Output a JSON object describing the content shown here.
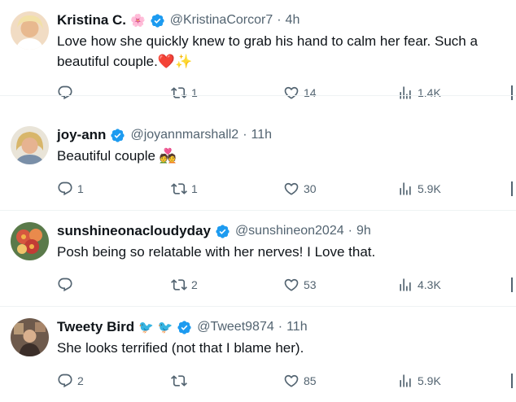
{
  "tweets": [
    {
      "name": "Kristina C.",
      "name_emoji": "🌸",
      "handle": "@KristinaCorcor7",
      "time": "4h",
      "text": "Love how she quickly knew to grab his hand to calm her fear.  Such a beautiful couple.",
      "text_emoji": "❤️✨",
      "replies": "",
      "retweets": "1",
      "likes": "14",
      "views": "1.4K",
      "avatar_color": "#e8c9a8"
    },
    {
      "name": "joy-ann",
      "name_emoji": "",
      "handle": "@joyannmarshall2",
      "time": "11h",
      "text": "Beautiful couple",
      "text_emoji": "💑",
      "replies": "1",
      "retweets": "1",
      "likes": "30",
      "views": "5.9K",
      "avatar_color": "#d9c089"
    },
    {
      "name": "sunshineonacloudyday",
      "name_emoji": "",
      "handle": "@sunshineon2024",
      "time": "9h",
      "text": "Posh being so relatable with her nerves! I Love that.",
      "text_emoji": "",
      "replies": "",
      "retweets": "2",
      "likes": "53",
      "views": "4.3K",
      "avatar_color": "#c24a3a"
    },
    {
      "name": "Tweety Bird",
      "name_emoji": "🐦 🐦",
      "handle": "@Tweet9874",
      "time": "11h",
      "text": "She looks terrified (not that I blame her).",
      "text_emoji": "",
      "replies": "2",
      "retweets": "",
      "likes": "85",
      "views": "5.9K",
      "avatar_color": "#8a6d5e"
    }
  ],
  "separator": "·",
  "colors": {
    "verified": "#1d9bf0",
    "muted": "#536471",
    "text": "#0f1419",
    "divider": "#eff3f4"
  },
  "icons": [
    "reply-icon",
    "retweet-icon",
    "like-icon",
    "views-icon",
    "verified-badge-icon"
  ]
}
